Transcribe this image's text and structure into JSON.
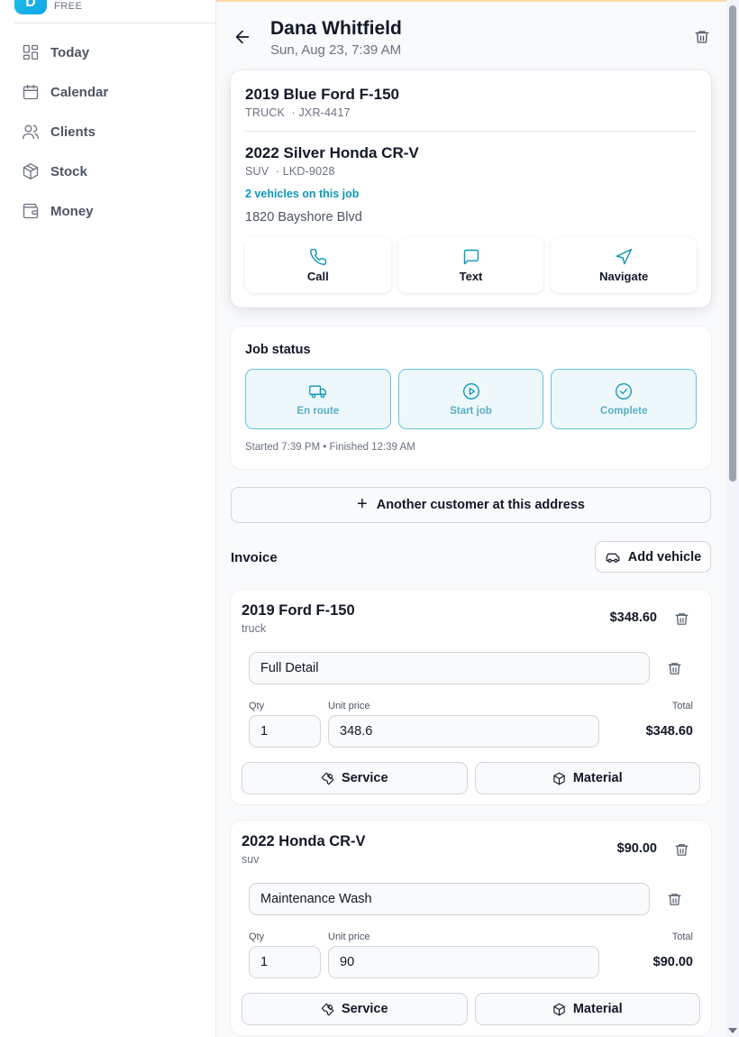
{
  "brand": {
    "logo_letter": "D",
    "plan": "FREE"
  },
  "sidebar": {
    "items": [
      {
        "label": "Today",
        "icon": "dashboard-icon"
      },
      {
        "label": "Calendar",
        "icon": "calendar-icon"
      },
      {
        "label": "Clients",
        "icon": "users-icon"
      },
      {
        "label": "Stock",
        "icon": "box-icon"
      },
      {
        "label": "Money",
        "icon": "wallet-icon"
      }
    ]
  },
  "header": {
    "title": "Dana Whitfield",
    "subtitle": "Sun, Aug 23, 7:39 AM"
  },
  "vehicles": [
    {
      "name": "2019 Blue Ford F-150",
      "type": "TRUCK",
      "plate": "· JXR-4417"
    },
    {
      "name": "2022 Silver Honda CR-V",
      "type": "SUV",
      "plate": "· LKD-9028"
    }
  ],
  "vehicle_count": "2 vehicles on this job",
  "address": "1820 Bayshore Blvd",
  "actions": {
    "call": "Call",
    "text": "Text",
    "navigate": "Navigate"
  },
  "job_status": {
    "title": "Job status",
    "en_route": "En route",
    "start_job": "Start job",
    "complete": "Complete",
    "times": "Started 7:39 PM • Finished 12:39 AM"
  },
  "another_customer": "Another customer at this address",
  "invoice": {
    "label": "Invoice",
    "add_vehicle": "Add vehicle",
    "qty_label": "Qty",
    "unit_price_label": "Unit price",
    "total_label": "Total",
    "service_label": "Service",
    "material_label": "Material",
    "items": [
      {
        "title": "2019 Ford F-150",
        "sub": "truck",
        "total": "$348.60",
        "line_name": "Full Detail",
        "qty": "1",
        "unit_price": "348.6",
        "line_total": "$348.60"
      },
      {
        "title": "2022 Honda CR-V",
        "sub": "suv",
        "total": "$90.00",
        "line_name": "Maintenance Wash",
        "qty": "1",
        "unit_price": "90",
        "line_total": "$90.00"
      }
    ]
  },
  "colors": {
    "accent": "#0e97b8",
    "status_border": "#67c3d8",
    "status_bg": "#eef8fb",
    "header_stripe": "#fcd9a6"
  }
}
